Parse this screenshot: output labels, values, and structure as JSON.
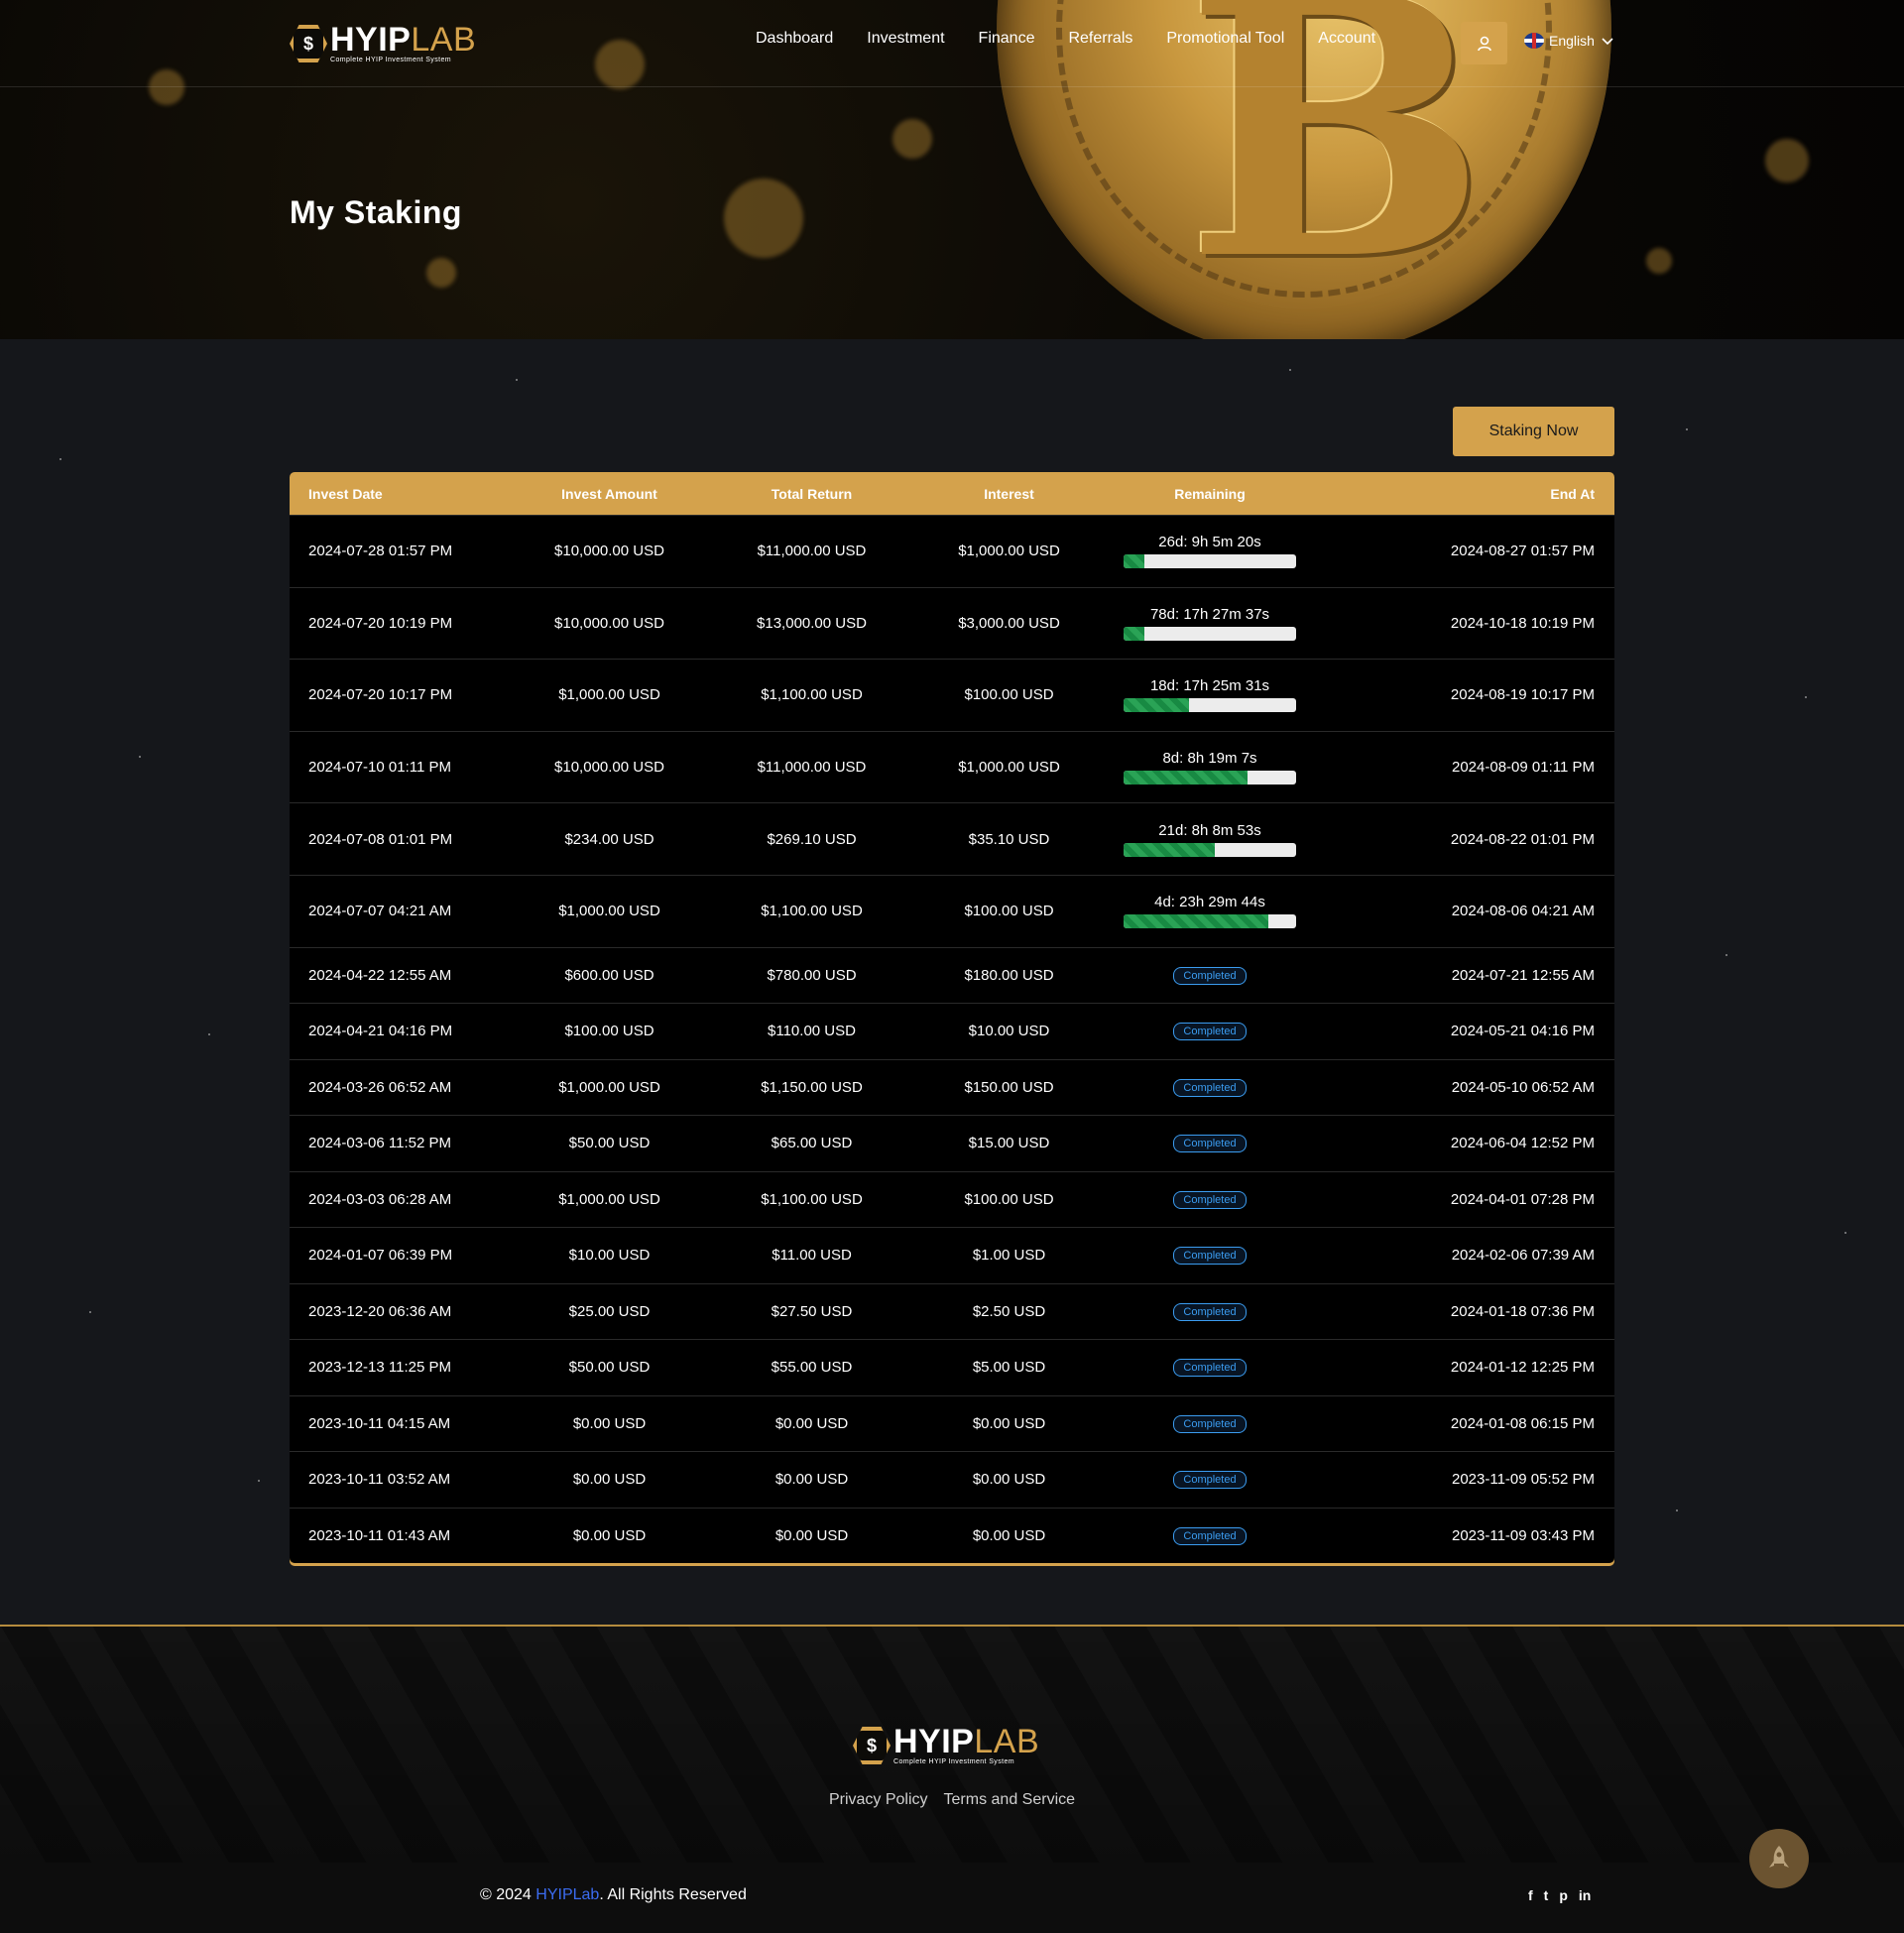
{
  "brand": {
    "logo_word_a": "HYIP",
    "logo_word_b": "LAB",
    "logo_sub": "Complete HYIP Investment System",
    "accent": "#d4a24c"
  },
  "nav": {
    "links": [
      "Dashboard",
      "Investment",
      "Finance",
      "Referrals",
      "Promotional Tool",
      "Account"
    ],
    "language": "English"
  },
  "page": {
    "title": "My Staking"
  },
  "actions": {
    "staking_now": "Staking Now"
  },
  "table": {
    "headers": [
      "Invest Date",
      "Invest Amount",
      "Total Return",
      "Interest",
      "Remaining",
      "End At"
    ],
    "rows": [
      {
        "date": "2024-07-28 01:57 PM",
        "amount": "$10,000.00 USD",
        "total": "$11,000.00 USD",
        "interest": "$1,000.00 USD",
        "remaining": "26d: 9h 5m 20s",
        "progress": 0.12,
        "end": "2024-08-27 01:57 PM"
      },
      {
        "date": "2024-07-20 10:19 PM",
        "amount": "$10,000.00 USD",
        "total": "$13,000.00 USD",
        "interest": "$3,000.00 USD",
        "remaining": "78d: 17h 27m 37s",
        "progress": 0.12,
        "end": "2024-10-18 10:19 PM"
      },
      {
        "date": "2024-07-20 10:17 PM",
        "amount": "$1,000.00 USD",
        "total": "$1,100.00 USD",
        "interest": "$100.00 USD",
        "remaining": "18d: 17h 25m 31s",
        "progress": 0.38,
        "end": "2024-08-19 10:17 PM"
      },
      {
        "date": "2024-07-10 01:11 PM",
        "amount": "$10,000.00 USD",
        "total": "$11,000.00 USD",
        "interest": "$1,000.00 USD",
        "remaining": "8d: 8h 19m 7s",
        "progress": 0.72,
        "end": "2024-08-09 01:11 PM"
      },
      {
        "date": "2024-07-08 01:01 PM",
        "amount": "$234.00 USD",
        "total": "$269.10 USD",
        "interest": "$35.10 USD",
        "remaining": "21d: 8h 8m 53s",
        "progress": 0.53,
        "end": "2024-08-22 01:01 PM"
      },
      {
        "date": "2024-07-07 04:21 AM",
        "amount": "$1,000.00 USD",
        "total": "$1,100.00 USD",
        "interest": "$100.00 USD",
        "remaining": "4d: 23h 29m 44s",
        "progress": 0.84,
        "end": "2024-08-06 04:21 AM"
      },
      {
        "date": "2024-04-22 12:55 AM",
        "amount": "$600.00 USD",
        "total": "$780.00 USD",
        "interest": "$180.00 USD",
        "status": "Completed",
        "end": "2024-07-21 12:55 AM"
      },
      {
        "date": "2024-04-21 04:16 PM",
        "amount": "$100.00 USD",
        "total": "$110.00 USD",
        "interest": "$10.00 USD",
        "status": "Completed",
        "end": "2024-05-21 04:16 PM"
      },
      {
        "date": "2024-03-26 06:52 AM",
        "amount": "$1,000.00 USD",
        "total": "$1,150.00 USD",
        "interest": "$150.00 USD",
        "status": "Completed",
        "end": "2024-05-10 06:52 AM"
      },
      {
        "date": "2024-03-06 11:52 PM",
        "amount": "$50.00 USD",
        "total": "$65.00 USD",
        "interest": "$15.00 USD",
        "status": "Completed",
        "end": "2024-06-04 12:52 PM"
      },
      {
        "date": "2024-03-03 06:28 AM",
        "amount": "$1,000.00 USD",
        "total": "$1,100.00 USD",
        "interest": "$100.00 USD",
        "status": "Completed",
        "end": "2024-04-01 07:28 PM"
      },
      {
        "date": "2024-01-07 06:39 PM",
        "amount": "$10.00 USD",
        "total": "$11.00 USD",
        "interest": "$1.00 USD",
        "status": "Completed",
        "end": "2024-02-06 07:39 AM"
      },
      {
        "date": "2023-12-20 06:36 AM",
        "amount": "$25.00 USD",
        "total": "$27.50 USD",
        "interest": "$2.50 USD",
        "status": "Completed",
        "end": "2024-01-18 07:36 PM"
      },
      {
        "date": "2023-12-13 11:25 PM",
        "amount": "$50.00 USD",
        "total": "$55.00 USD",
        "interest": "$5.00 USD",
        "status": "Completed",
        "end": "2024-01-12 12:25 PM"
      },
      {
        "date": "2023-10-11 04:15 AM",
        "amount": "$0.00 USD",
        "total": "$0.00 USD",
        "interest": "$0.00 USD",
        "status": "Completed",
        "end": "2024-01-08 06:15 PM"
      },
      {
        "date": "2023-10-11 03:52 AM",
        "amount": "$0.00 USD",
        "total": "$0.00 USD",
        "interest": "$0.00 USD",
        "status": "Completed",
        "end": "2023-11-09 05:52 PM"
      },
      {
        "date": "2023-10-11 01:43 AM",
        "amount": "$0.00 USD",
        "total": "$0.00 USD",
        "interest": "$0.00 USD",
        "status": "Completed",
        "end": "2023-11-09 03:43 PM"
      }
    ]
  },
  "footer": {
    "links": [
      "Privacy Policy",
      "Terms and Service"
    ],
    "copyright_prefix": "© 2024 ",
    "copyright_brand": "HYIPLab",
    "copyright_suffix": ". All Rights Reserved",
    "socials": [
      "f",
      "t",
      "p",
      "in"
    ]
  },
  "icons": {
    "user": "user-icon",
    "chevron": "chevron-down-icon",
    "rocket": "rocket-icon"
  }
}
